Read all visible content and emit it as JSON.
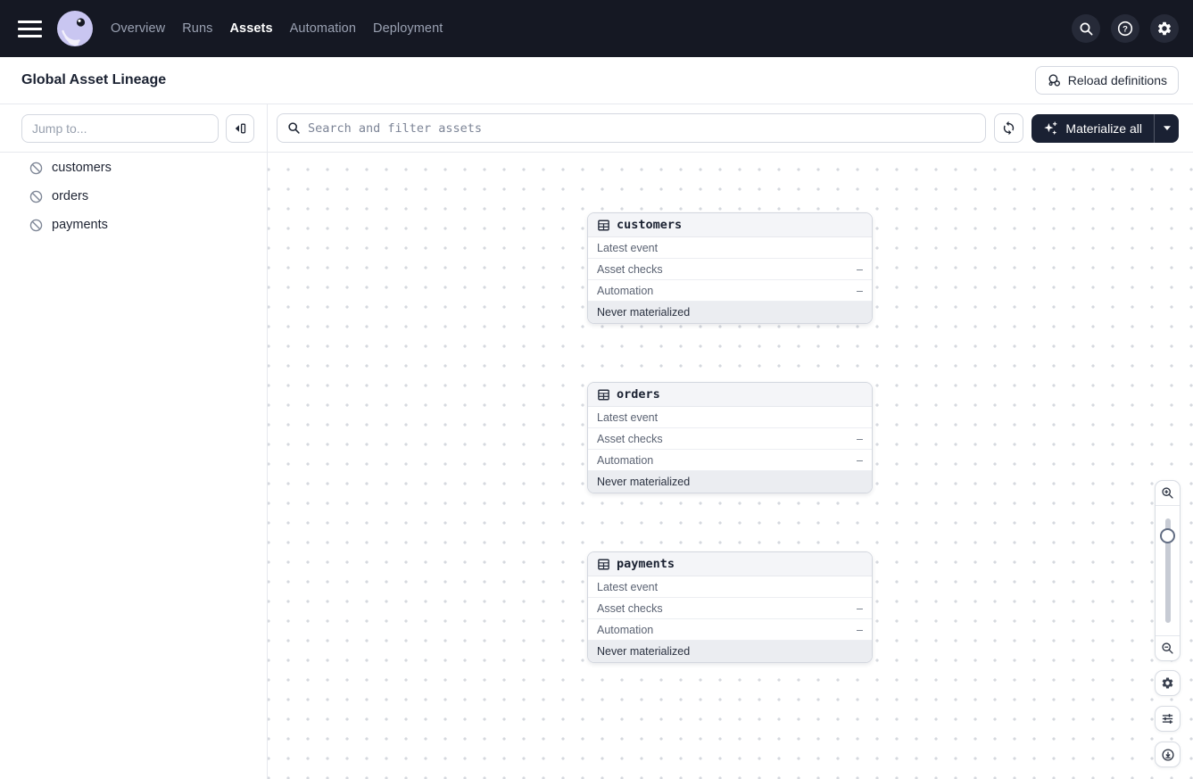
{
  "nav": {
    "links": [
      {
        "label": "Overview"
      },
      {
        "label": "Runs"
      },
      {
        "label": "Assets"
      },
      {
        "label": "Automation"
      },
      {
        "label": "Deployment"
      }
    ],
    "active_link": "Assets",
    "icons": [
      "search-icon",
      "help-icon",
      "gear-icon"
    ]
  },
  "header": {
    "title": "Global Asset Lineage",
    "reload_label": "Reload definitions"
  },
  "sidebar": {
    "jump_placeholder": "Jump to...",
    "items": [
      {
        "label": "customers",
        "icon": "no-materialization-icon"
      },
      {
        "label": "orders",
        "icon": "no-materialization-icon"
      },
      {
        "label": "payments",
        "icon": "no-materialization-icon"
      }
    ]
  },
  "toolbar": {
    "search_placeholder": "Search and filter assets",
    "materialize_label": "Materialize all"
  },
  "graph": {
    "nodes": [
      {
        "name": "customers",
        "icon": "table-icon",
        "rows": [
          {
            "label": "Latest event",
            "value": ""
          },
          {
            "label": "Asset checks",
            "value": "–"
          },
          {
            "label": "Automation",
            "value": "–"
          }
        ],
        "footer": "Never materialized"
      },
      {
        "name": "orders",
        "icon": "table-icon",
        "rows": [
          {
            "label": "Latest event",
            "value": ""
          },
          {
            "label": "Asset checks",
            "value": "–"
          },
          {
            "label": "Automation",
            "value": "–"
          }
        ],
        "footer": "Never materialized"
      },
      {
        "name": "payments",
        "icon": "table-icon",
        "rows": [
          {
            "label": "Latest event",
            "value": ""
          },
          {
            "label": "Asset checks",
            "value": "–"
          },
          {
            "label": "Automation",
            "value": "–"
          }
        ],
        "footer": "Never materialized"
      }
    ],
    "controls": [
      "zoom-in-icon",
      "zoom-slider",
      "zoom-out-icon",
      "gear-icon",
      "tune-icon",
      "download-icon"
    ]
  },
  "colors": {
    "nav_bg": "#151823",
    "logo_lavender": "#C9C6F1",
    "dark_button_bg": "#1A2133",
    "node_header_bg": "#F4F5F8",
    "node_footer_bg": "#EBEDF1",
    "border": "#D4D8E0",
    "canvas_dot": "#D5D8DE"
  }
}
